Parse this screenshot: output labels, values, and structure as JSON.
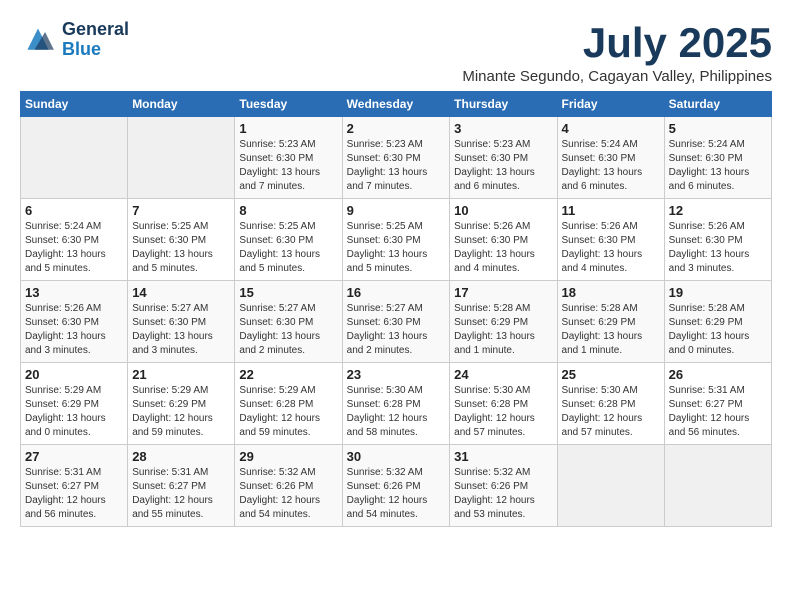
{
  "header": {
    "logo_line1": "General",
    "logo_line2": "Blue",
    "month": "July 2025",
    "location": "Minante Segundo, Cagayan Valley, Philippines"
  },
  "weekdays": [
    "Sunday",
    "Monday",
    "Tuesday",
    "Wednesday",
    "Thursday",
    "Friday",
    "Saturday"
  ],
  "weeks": [
    [
      {
        "day": "",
        "info": ""
      },
      {
        "day": "",
        "info": ""
      },
      {
        "day": "1",
        "info": "Sunrise: 5:23 AM\nSunset: 6:30 PM\nDaylight: 13 hours and 7 minutes."
      },
      {
        "day": "2",
        "info": "Sunrise: 5:23 AM\nSunset: 6:30 PM\nDaylight: 13 hours and 7 minutes."
      },
      {
        "day": "3",
        "info": "Sunrise: 5:23 AM\nSunset: 6:30 PM\nDaylight: 13 hours and 6 minutes."
      },
      {
        "day": "4",
        "info": "Sunrise: 5:24 AM\nSunset: 6:30 PM\nDaylight: 13 hours and 6 minutes."
      },
      {
        "day": "5",
        "info": "Sunrise: 5:24 AM\nSunset: 6:30 PM\nDaylight: 13 hours and 6 minutes."
      }
    ],
    [
      {
        "day": "6",
        "info": "Sunrise: 5:24 AM\nSunset: 6:30 PM\nDaylight: 13 hours and 5 minutes."
      },
      {
        "day": "7",
        "info": "Sunrise: 5:25 AM\nSunset: 6:30 PM\nDaylight: 13 hours and 5 minutes."
      },
      {
        "day": "8",
        "info": "Sunrise: 5:25 AM\nSunset: 6:30 PM\nDaylight: 13 hours and 5 minutes."
      },
      {
        "day": "9",
        "info": "Sunrise: 5:25 AM\nSunset: 6:30 PM\nDaylight: 13 hours and 5 minutes."
      },
      {
        "day": "10",
        "info": "Sunrise: 5:26 AM\nSunset: 6:30 PM\nDaylight: 13 hours and 4 minutes."
      },
      {
        "day": "11",
        "info": "Sunrise: 5:26 AM\nSunset: 6:30 PM\nDaylight: 13 hours and 4 minutes."
      },
      {
        "day": "12",
        "info": "Sunrise: 5:26 AM\nSunset: 6:30 PM\nDaylight: 13 hours and 3 minutes."
      }
    ],
    [
      {
        "day": "13",
        "info": "Sunrise: 5:26 AM\nSunset: 6:30 PM\nDaylight: 13 hours and 3 minutes."
      },
      {
        "day": "14",
        "info": "Sunrise: 5:27 AM\nSunset: 6:30 PM\nDaylight: 13 hours and 3 minutes."
      },
      {
        "day": "15",
        "info": "Sunrise: 5:27 AM\nSunset: 6:30 PM\nDaylight: 13 hours and 2 minutes."
      },
      {
        "day": "16",
        "info": "Sunrise: 5:27 AM\nSunset: 6:30 PM\nDaylight: 13 hours and 2 minutes."
      },
      {
        "day": "17",
        "info": "Sunrise: 5:28 AM\nSunset: 6:29 PM\nDaylight: 13 hours and 1 minute."
      },
      {
        "day": "18",
        "info": "Sunrise: 5:28 AM\nSunset: 6:29 PM\nDaylight: 13 hours and 1 minute."
      },
      {
        "day": "19",
        "info": "Sunrise: 5:28 AM\nSunset: 6:29 PM\nDaylight: 13 hours and 0 minutes."
      }
    ],
    [
      {
        "day": "20",
        "info": "Sunrise: 5:29 AM\nSunset: 6:29 PM\nDaylight: 13 hours and 0 minutes."
      },
      {
        "day": "21",
        "info": "Sunrise: 5:29 AM\nSunset: 6:29 PM\nDaylight: 12 hours and 59 minutes."
      },
      {
        "day": "22",
        "info": "Sunrise: 5:29 AM\nSunset: 6:28 PM\nDaylight: 12 hours and 59 minutes."
      },
      {
        "day": "23",
        "info": "Sunrise: 5:30 AM\nSunset: 6:28 PM\nDaylight: 12 hours and 58 minutes."
      },
      {
        "day": "24",
        "info": "Sunrise: 5:30 AM\nSunset: 6:28 PM\nDaylight: 12 hours and 57 minutes."
      },
      {
        "day": "25",
        "info": "Sunrise: 5:30 AM\nSunset: 6:28 PM\nDaylight: 12 hours and 57 minutes."
      },
      {
        "day": "26",
        "info": "Sunrise: 5:31 AM\nSunset: 6:27 PM\nDaylight: 12 hours and 56 minutes."
      }
    ],
    [
      {
        "day": "27",
        "info": "Sunrise: 5:31 AM\nSunset: 6:27 PM\nDaylight: 12 hours and 56 minutes."
      },
      {
        "day": "28",
        "info": "Sunrise: 5:31 AM\nSunset: 6:27 PM\nDaylight: 12 hours and 55 minutes."
      },
      {
        "day": "29",
        "info": "Sunrise: 5:32 AM\nSunset: 6:26 PM\nDaylight: 12 hours and 54 minutes."
      },
      {
        "day": "30",
        "info": "Sunrise: 5:32 AM\nSunset: 6:26 PM\nDaylight: 12 hours and 54 minutes."
      },
      {
        "day": "31",
        "info": "Sunrise: 5:32 AM\nSunset: 6:26 PM\nDaylight: 12 hours and 53 minutes."
      },
      {
        "day": "",
        "info": ""
      },
      {
        "day": "",
        "info": ""
      }
    ]
  ]
}
